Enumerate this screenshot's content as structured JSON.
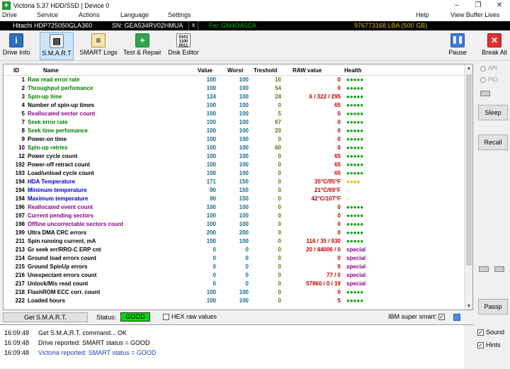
{
  "window": {
    "title": "Victoria 5.37 HDD/SSD | Device 0",
    "app_icon_glyph": "+",
    "min_glyph": "–",
    "max_glyph": "❐",
    "close_glyph": "✕"
  },
  "menu": {
    "items": [
      "Drive",
      "Service",
      "Actions",
      "Language",
      "Settings"
    ],
    "help": "Help",
    "view_buffer": "View Buffer Lives"
  },
  "drive_info": {
    "model": "Hitachi HDP725050GLA360",
    "serial": "SN: GEA534RV02HMUA",
    "close_mark": "x",
    "firmware": "Fw: GM4OA5CA",
    "capacity": "976773168 LBA (500 GB)"
  },
  "toolbar": {
    "drive_info": "Drive Info",
    "smart": "S.M.A.R.T",
    "smart_logs": "SMART Logs",
    "test_repair": "Test & Repair",
    "disk_editor": "Disk Editor",
    "pause": "Pause",
    "break_all": "Break All",
    "icons": {
      "drive_info": "info-icon",
      "smart": "smart-chart-icon",
      "smart_logs": "folder-log-icon",
      "test_repair": "plus-repair-icon",
      "disk_editor": "binary-editor-icon",
      "pause": "pause-icon",
      "break_all": "close-icon"
    }
  },
  "grid": {
    "headers": [
      "ID",
      "Name",
      "Value",
      "Worst",
      "Treshold",
      "RAW value",
      "Health"
    ],
    "rows": [
      {
        "id": "1",
        "name": "Raw read error rate",
        "value": "100",
        "worst": "100",
        "thr": "16",
        "raw": "0",
        "health": "●●●●●",
        "name_color": "#008000",
        "health_color": "#00a000"
      },
      {
        "id": "2",
        "name": "Throughput perfomance",
        "value": "100",
        "worst": "100",
        "thr": "54",
        "raw": "0",
        "health": "●●●●●",
        "name_color": "#008000",
        "health_color": "#00a000"
      },
      {
        "id": "3",
        "name": "Spin-up time",
        "value": "124",
        "worst": "100",
        "thr": "24",
        "raw": "6 / 322 / 295",
        "health": "●●●●●",
        "name_color": "#008000",
        "health_color": "#00a000"
      },
      {
        "id": "4",
        "name": "Number of spin-up times",
        "value": "100",
        "worst": "100",
        "thr": "0",
        "raw": "65",
        "health": "●●●●●",
        "name_color": "#000000",
        "health_color": "#00a000"
      },
      {
        "id": "5",
        "name": "Reallocated sector count",
        "value": "100",
        "worst": "100",
        "thr": "5",
        "raw": "0",
        "health": "●●●●●",
        "name_color": "#8b008b",
        "health_color": "#00a000"
      },
      {
        "id": "7",
        "name": "Seek error rate",
        "value": "100",
        "worst": "100",
        "thr": "67",
        "raw": "0",
        "health": "●●●●●",
        "name_color": "#008000",
        "health_color": "#00a000"
      },
      {
        "id": "8",
        "name": "Seek time perfomance",
        "value": "100",
        "worst": "100",
        "thr": "20",
        "raw": "0",
        "health": "●●●●●",
        "name_color": "#008000",
        "health_color": "#00a000"
      },
      {
        "id": "9",
        "name": "Power-on time",
        "value": "100",
        "worst": "100",
        "thr": "0",
        "raw": "0",
        "health": "●●●●●",
        "name_color": "#000000",
        "health_color": "#00a000"
      },
      {
        "id": "10",
        "name": "Spin-up retries",
        "value": "100",
        "worst": "100",
        "thr": "60",
        "raw": "0",
        "health": "●●●●●",
        "name_color": "#008000",
        "health_color": "#00a000"
      },
      {
        "id": "12",
        "name": "Power cycle count",
        "value": "100",
        "worst": "100",
        "thr": "0",
        "raw": "65",
        "health": "●●●●●",
        "name_color": "#000000",
        "health_color": "#00a000"
      },
      {
        "id": "192",
        "name": "Power-off retract count",
        "value": "100",
        "worst": "100",
        "thr": "0",
        "raw": "65",
        "health": "●●●●●",
        "name_color": "#000000",
        "health_color": "#00a000"
      },
      {
        "id": "193",
        "name": "Load/unload cycle count",
        "value": "100",
        "worst": "100",
        "thr": "0",
        "raw": "65",
        "health": "●●●●●",
        "name_color": "#000000",
        "health_color": "#00a000"
      },
      {
        "id": "194",
        "name": "HDA Temperature",
        "value": "171",
        "worst": "150",
        "thr": "0",
        "raw": "35°C/95°F",
        "health": "●●●●",
        "name_color": "#0000cd",
        "health_color": "#d4c000"
      },
      {
        "id": "194",
        "name": "Minimum temperature",
        "value": "90",
        "worst": "150",
        "thr": "0",
        "raw": "21°C/69°F",
        "health": "-",
        "name_color": "#0000cd",
        "health_color": "#d4c000"
      },
      {
        "id": "194",
        "name": "Maximum temperature",
        "value": "90",
        "worst": "150",
        "thr": "0",
        "raw": "42°C/107°F",
        "health": "-",
        "name_color": "#0000cd",
        "health_color": "#d4c000"
      },
      {
        "id": "196",
        "name": "Reallocated event count",
        "value": "100",
        "worst": "100",
        "thr": "0",
        "raw": "0",
        "health": "●●●●●",
        "name_color": "#8b008b",
        "health_color": "#00a000"
      },
      {
        "id": "197",
        "name": "Current pending sectors",
        "value": "100",
        "worst": "100",
        "thr": "0",
        "raw": "0",
        "health": "●●●●●",
        "name_color": "#8b008b",
        "health_color": "#00a000"
      },
      {
        "id": "198",
        "name": "Offline uncorrectable sectors count",
        "value": "100",
        "worst": "100",
        "thr": "0",
        "raw": "0",
        "health": "●●●●●",
        "name_color": "#8b008b",
        "health_color": "#00a000"
      },
      {
        "id": "199",
        "name": "Ultra DMA CRC errors",
        "value": "200",
        "worst": "200",
        "thr": "0",
        "raw": "0",
        "health": "●●●●●",
        "name_color": "#000000",
        "health_color": "#00a000"
      },
      {
        "id": "211",
        "name": "Spin running current, mA",
        "value": "100",
        "worst": "100",
        "thr": "0",
        "raw": "116 / 35 / 930",
        "health": "●●●●●",
        "name_color": "#000000",
        "health_color": "#00a000"
      },
      {
        "id": "213",
        "name": "Gr seek err/RRO-C ERP cnt",
        "value": "0",
        "worst": "0",
        "thr": "0",
        "raw": "20 / 44006 / 0",
        "health": "special",
        "name_color": "#000000",
        "health_color": "#8b008b"
      },
      {
        "id": "214",
        "name": "Ground load errors count",
        "value": "0",
        "worst": "0",
        "thr": "0",
        "raw": "0",
        "health": "special",
        "name_color": "#000000",
        "health_color": "#8b008b"
      },
      {
        "id": "215",
        "name": "Ground SpinUp errors",
        "value": "0",
        "worst": "0",
        "thr": "0",
        "raw": "0",
        "health": "special",
        "name_color": "#000000",
        "health_color": "#8b008b"
      },
      {
        "id": "216",
        "name": "Unexpectant errors count",
        "value": "0",
        "worst": "0",
        "thr": "0",
        "raw": "77 / 0",
        "health": "special",
        "name_color": "#000000",
        "health_color": "#8b008b"
      },
      {
        "id": "217",
        "name": "Unlock/Mis read count",
        "value": "0",
        "worst": "0",
        "thr": "0",
        "raw": "57860 / 0 / 19",
        "health": "special",
        "name_color": "#000000",
        "health_color": "#8b008b"
      },
      {
        "id": "218",
        "name": "FlashROM ECC corr. count",
        "value": "100",
        "worst": "100",
        "thr": "0",
        "raw": "0",
        "health": "●●●●●",
        "name_color": "#000000",
        "health_color": "#00a000"
      },
      {
        "id": "222",
        "name": "Loaded hours",
        "value": "100",
        "worst": "100",
        "thr": "0",
        "raw": "5",
        "health": "●●●●●",
        "name_color": "#000000",
        "health_color": "#00a000"
      }
    ]
  },
  "right_panel": {
    "api": "API",
    "pio": "PIO",
    "sleep": "Sleep",
    "recall": "Recall",
    "passp": "Passp"
  },
  "status": {
    "get_smart": "Get S.M.A.R.T.",
    "status_label": "Status:",
    "status_value": "GOOD",
    "status_color": "#00d800",
    "hex_raw": "HEX raw values",
    "ibm_label": "IBM super smart:",
    "ibm_checked": "✓"
  },
  "log": {
    "lines": [
      {
        "time": "16:09:48",
        "text": "Get S.M.A.R.T. command... OK",
        "color": "#000000"
      },
      {
        "time": "16:09:48",
        "text": "Drive reported: SMART status = GOOD",
        "color": "#000000"
      },
      {
        "time": "16:09:48",
        "text": "Victoria reported: SMART status = GOOD",
        "color": "#1a3fb0"
      }
    ]
  },
  "bottom_options": {
    "sound": "Sound",
    "hints": "Hints",
    "checked": "✓"
  }
}
